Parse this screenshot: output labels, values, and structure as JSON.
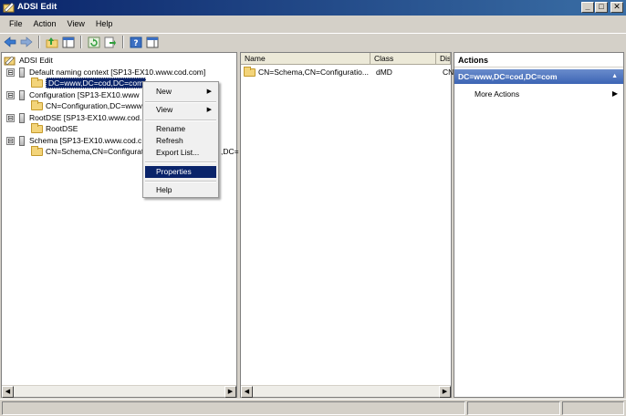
{
  "window": {
    "title": "ADSI Edit",
    "minimize": "_",
    "maximize": "□",
    "close": "✕"
  },
  "menubar": [
    {
      "label": "File"
    },
    {
      "label": "Action"
    },
    {
      "label": "View"
    },
    {
      "label": "Help"
    }
  ],
  "tree": {
    "root": "ADSI Edit",
    "nodes": [
      {
        "label": "Default naming context [SP13-EX10.www.cod.com]",
        "expander": "⊟"
      },
      {
        "label": "DC=www,DC=cod,DC=com"
      },
      {
        "label": "Configuration [SP13-EX10.www",
        "expander": "⊟"
      },
      {
        "label": "CN=Configuration,DC=www"
      },
      {
        "label": "RootDSE [SP13-EX10.www.cod.",
        "expander": "⊟"
      },
      {
        "label": "RootDSE"
      },
      {
        "label": "Schema [SP13-EX10.www.cod.c",
        "expander": "⊟"
      },
      {
        "label": "CN=Schema,CN=Configurat",
        "overflow_tail": ",DC="
      }
    ]
  },
  "context_menu": {
    "items": [
      {
        "label": "New",
        "submenu": "▶"
      },
      {
        "label": "View",
        "submenu": "▶"
      },
      {
        "label": "Rename"
      },
      {
        "label": "Refresh"
      },
      {
        "label": "Export List..."
      },
      {
        "label": "Properties"
      },
      {
        "label": "Help"
      }
    ]
  },
  "list": {
    "columns": [
      "Name",
      "Class",
      "Dis"
    ],
    "rows": [
      {
        "name": "CN=Schema,CN=Configuratio...",
        "class": "dMD",
        "dis": "CN"
      }
    ]
  },
  "actions": {
    "title": "Actions",
    "section": "DC=www,DC=cod,DC=com",
    "collapse_glyph": "▲",
    "more_actions": "More Actions",
    "more_arrow": "▶"
  },
  "scroll": {
    "left": "◀",
    "right": "▶"
  }
}
